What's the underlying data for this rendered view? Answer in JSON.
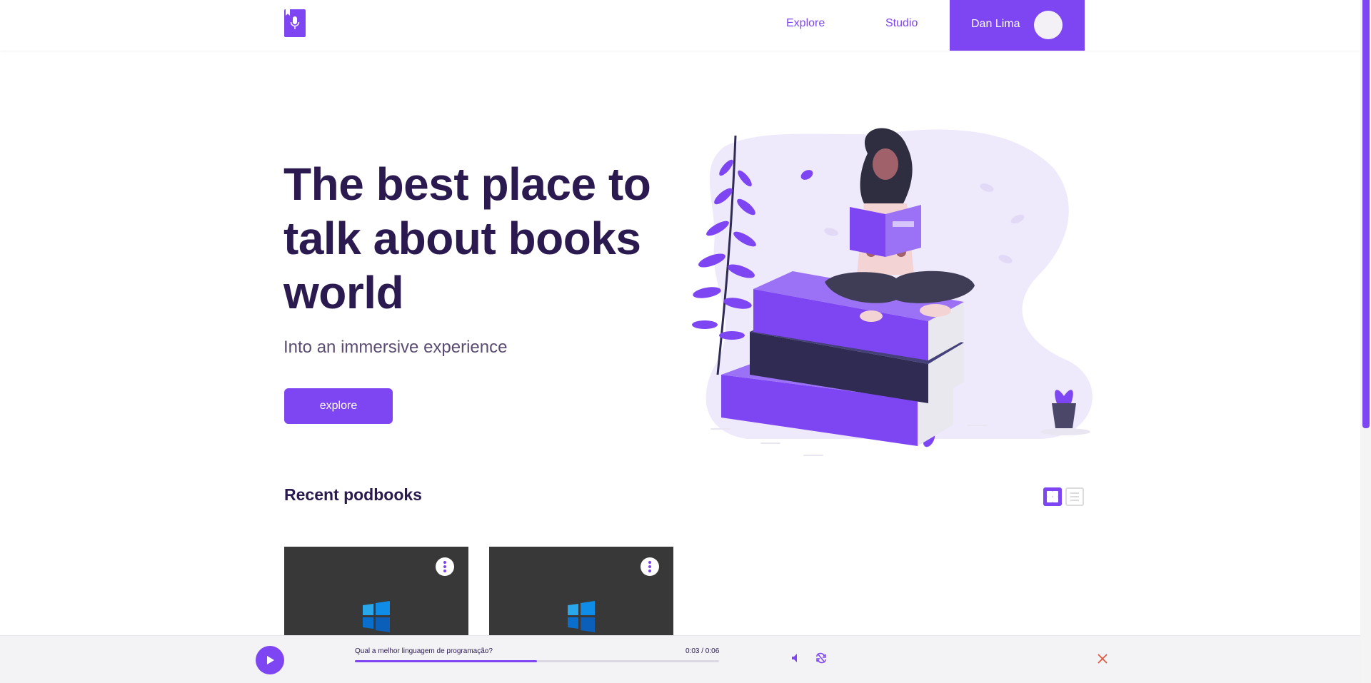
{
  "header": {
    "logo_icon": "microphone-icon",
    "nav": [
      {
        "label": "Explore"
      },
      {
        "label": "Studio"
      }
    ],
    "user": {
      "name": "Dan Lima"
    }
  },
  "hero": {
    "title": "The best place to talk about books world",
    "subtitle": "Into an immersive experience",
    "button_label": "explore"
  },
  "recent": {
    "title": "Recent podbooks",
    "view_modes": [
      "grid-view-icon",
      "list-view-icon"
    ],
    "active_view": "grid",
    "cards": [
      {
        "thumbnail_icon": "windows-logo-icon",
        "menu_icon": "more-vertical-icon"
      },
      {
        "thumbnail_icon": "windows-logo-icon",
        "menu_icon": "more-vertical-icon"
      }
    ]
  },
  "player": {
    "track_title": "Qual a melhor linguagem de programação?",
    "time": "0:03 / 0:06",
    "progress": 0.5,
    "icons": [
      "play-icon",
      "volume-icon",
      "loop-icon",
      "close-icon"
    ]
  },
  "colors": {
    "accent": "#7e46f2",
    "title": "#2b1a4f",
    "card_bg": "#383838",
    "player_bg": "#f3f2f5",
    "close": "#e0533a"
  }
}
